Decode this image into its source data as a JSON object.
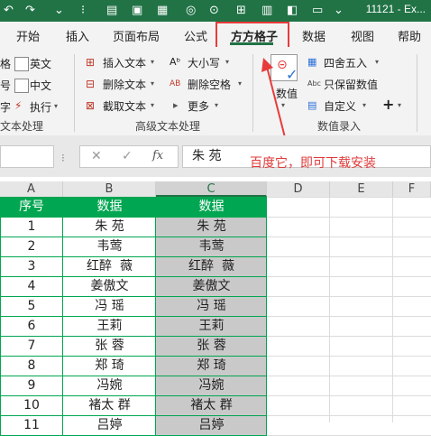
{
  "titlebar": {
    "filename": "11121 - Ex..."
  },
  "tabs": [
    {
      "label": "开始"
    },
    {
      "label": "插入"
    },
    {
      "label": "页面布局"
    },
    {
      "label": "公式"
    },
    {
      "label": "方方格子"
    },
    {
      "label": "数据"
    },
    {
      "label": "视图"
    },
    {
      "label": "帮助"
    }
  ],
  "ribbon": {
    "left_partial": [
      "格",
      "号",
      "字"
    ],
    "left_items": [
      "英文",
      "中文",
      "执行"
    ],
    "group1_label": "文本处理",
    "adv_items": [
      "插入文本",
      "删除文本",
      "截取文本",
      "大小写",
      "删除空格",
      "更多"
    ],
    "group2_label": "高级文本处理",
    "numeric_label": "数值",
    "num_items": [
      "四舍五入",
      "只保留数值",
      "自定义"
    ],
    "group3_label": "数值录入",
    "colors": {
      "green": "#217346",
      "grid_green": "#00a651",
      "red": "#e83b3b"
    }
  },
  "formula_bar": {
    "value": "朱 苑",
    "fx": "fx"
  },
  "annotation": "百度它，即可下载安装",
  "columns": [
    "A",
    "B",
    "C",
    "D",
    "E",
    "F"
  ],
  "table": {
    "headers": [
      "序号",
      "数据",
      "数据"
    ],
    "rows": [
      [
        "1",
        "朱 苑",
        "朱 苑"
      ],
      [
        "2",
        "韦莺",
        "韦莺"
      ],
      [
        "3",
        "红醉  薇",
        "红醉  薇"
      ],
      [
        "4",
        "姜傲文",
        "姜傲文"
      ],
      [
        "5",
        "冯 瑶",
        "冯 瑶"
      ],
      [
        "6",
        "王莉",
        "王莉"
      ],
      [
        "7",
        "张 蓉",
        "张 蓉"
      ],
      [
        "8",
        "郑 琦",
        "郑 琦"
      ],
      [
        "9",
        "冯婉",
        "冯婉"
      ],
      [
        "10",
        "褚太 群",
        "褚太 群"
      ],
      [
        "11",
        "吕婷",
        "吕婷"
      ]
    ]
  }
}
